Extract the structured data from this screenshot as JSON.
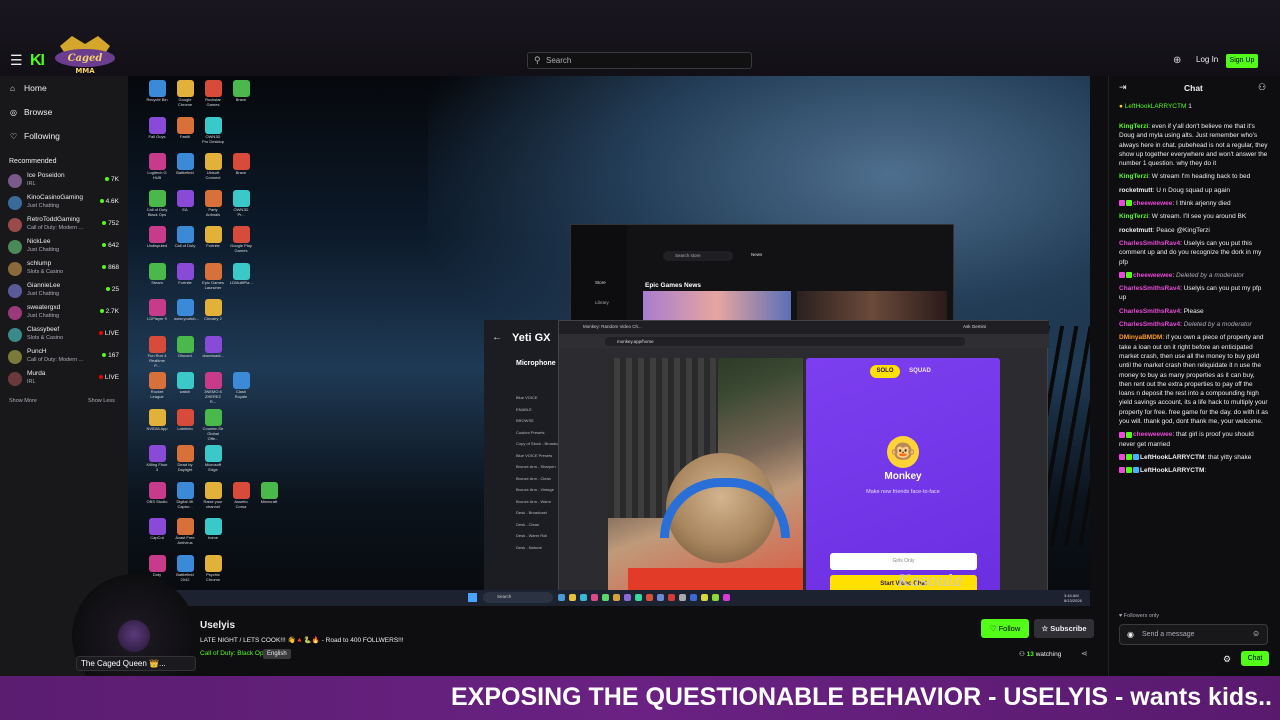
{
  "topbar": {
    "logo_text": "The Caged Queen MMA",
    "kick_text": "KI",
    "search_placeholder": "Search",
    "login_label": "Log In",
    "signup_label": "Sign Up"
  },
  "sidebar": {
    "nav": [
      {
        "label": "Home",
        "icon": "home-icon"
      },
      {
        "label": "Browse",
        "icon": "compass-icon"
      },
      {
        "label": "Following",
        "icon": "heart-icon"
      }
    ],
    "recommended_title": "Recommended",
    "channels": [
      {
        "name": "Ice Poseidon",
        "category": "IRL",
        "viewers": "7K",
        "live": false
      },
      {
        "name": "KinoCasinoGaming",
        "category": "Just Chatting",
        "viewers": "4.6K",
        "live": false
      },
      {
        "name": "RetroToddGaming",
        "category": "Call of Duty: Modern ...",
        "viewers": "752",
        "live": false
      },
      {
        "name": "NickLee",
        "category": "Just Chatting",
        "viewers": "642",
        "live": false
      },
      {
        "name": "schlump",
        "category": "Slots & Casino",
        "viewers": "868",
        "live": false
      },
      {
        "name": "GiannieLee",
        "category": "Just Chatting",
        "viewers": "25",
        "live": false
      },
      {
        "name": "sweatergxd",
        "category": "Just Chatting",
        "viewers": "2.7K",
        "live": false
      },
      {
        "name": "Classybeef",
        "category": "Slots & Casino",
        "viewers": "LIVE",
        "live": true
      },
      {
        "name": "PuncH",
        "category": "Call of Duty: Modern ...",
        "viewers": "167",
        "live": false
      },
      {
        "name": "Murda",
        "category": "IRL",
        "viewers": "LIVE",
        "live": true
      }
    ],
    "show_more": "Show More",
    "show_less": "Show Less"
  },
  "desktop": {
    "icons": [
      "Recycle Bin",
      "Google Chrome",
      "Rockstar Games",
      "Brave",
      "Fall Guys",
      "Fastill",
      "OWN3D Pro Desktop",
      "Logitech G HUB",
      "Battlefield",
      "Ubisoft Connect",
      "Brave",
      "Call of Duty Black Ops",
      "EA",
      "Party Animals",
      "OWN3D Pr...",
      "Undisputed",
      "Call of Duty",
      "Fortnite",
      "Google Play Games",
      "Steam",
      "Fortnite",
      "Epic Games Launcher",
      "LDMultiPla...",
      "LDPlayer 9",
      "www.youtub...",
      "Chivalry 2",
      "Fun Run 4 Realtime P...",
      "Discord",
      "downloadi...",
      "Rocket League",
      "watch",
      "3NEMO 8 ZHEREZ R...",
      "Clash Royale",
      "NVIDIA App",
      "Labirinto",
      "Counter-Str Global Offe...",
      "Killing Floor 3",
      "Dead by Daylight",
      "Microsoft Edge",
      "OBS Studio",
      "Digital 4K Captur...",
      "Raise your channel",
      "Assetto Corsa",
      "Minecraft",
      "CapCut",
      "Avast Free Antivirus",
      "home",
      "Duty",
      "Battlefield 2042",
      "Psychic Chrome"
    ],
    "epic": {
      "search": "Search store",
      "tab": "News",
      "store": "Store",
      "library": "Library",
      "heading": "Epic Games News"
    },
    "yeti": {
      "title": "Yeti GX",
      "mic": "Microphone",
      "rows": [
        "Blue VOICE",
        "ENABLE",
        "BROWSE",
        "Custom Presets",
        "Copy of Stock - Broadcast",
        "Blue VOICE Presets",
        "Bronze Arm - Sharpen",
        "Bronze Arm - Clean",
        "Bronze Arm - Vintage",
        "Bronze Arm - Warm",
        "Desk - Broadcast",
        "Desk - Clean",
        "Desk - Warm Roll",
        "Desk - Natural"
      ]
    },
    "monkey": {
      "tab_title": "Monkey: Random Video Ch...",
      "url": "monkey.app/home",
      "ask_label": "Ask Gemini",
      "solo": "SOLO",
      "squad": "SQUAD",
      "title": "Monkey",
      "subtitle": "Make new friends face-to-face",
      "girls_only": "Girls Only",
      "start": "Start Video Chat"
    },
    "taskbar": {
      "search": "Search",
      "time": "3:44 AM",
      "date": "8/13/2026"
    },
    "signature": "Kasoula"
  },
  "stream": {
    "streamer": "Uselyis",
    "title": "LATE NIGHT / LETS COOK!!! 👋🔺🐍🔥 - Road to 400 FOLLWERS!!!",
    "category": "Call of Duty: Black Ops",
    "language": "English",
    "follow_label": "Follow",
    "subscribe_label": "Subscribe",
    "viewer_count": "13",
    "watching_label": "watching",
    "overlay_tag": "The Caged Queen 👑..."
  },
  "chat": {
    "title": "Chat",
    "pinned": {
      "user": "LeftHookLARRYCTM",
      "count": "1"
    },
    "messages": [
      {
        "user": "KingTerzi",
        "color": "#53fc18",
        "text": "even if y'all don't believe me that it's Doug and myla using alts. Just remember who's always here in chat. pubehead is not a regular, they show up together everywhere and won't answer the number 1 question. why they do it",
        "badges": 0,
        "deleted": false
      },
      {
        "user": "KingTerzi",
        "color": "#53fc18",
        "text": "W stream I'm heading back to bed",
        "badges": 0,
        "deleted": false
      },
      {
        "user": "rocketmutt",
        "color": "#efeff1",
        "text": "U n Doug squad up again",
        "badges": 0,
        "deleted": false
      },
      {
        "user": "cheeweewee",
        "color": "#e94ad9",
        "text": "I think arjenny died",
        "badges": 2,
        "deleted": false
      },
      {
        "user": "KingTerzi",
        "color": "#53fc18",
        "text": "W stream. I'll see you around BK",
        "badges": 0,
        "deleted": false
      },
      {
        "user": "rocketmutt",
        "color": "#efeff1",
        "text": "Peace @KingTerzi",
        "badges": 0,
        "deleted": false
      },
      {
        "user": "CharlesSmithsRav4",
        "color": "#e94ad9",
        "text": "Uselyis can you put this comment up and do you recognize the dork in my pfp",
        "badges": 0,
        "deleted": false
      },
      {
        "user": "cheeweewee",
        "color": "#e94ad9",
        "text": "Deleted by a moderator",
        "badges": 2,
        "deleted": true
      },
      {
        "user": "CharlesSmithsRav4",
        "color": "#e94ad9",
        "text": "Uselyis can you put my pfp up",
        "badges": 0,
        "deleted": false
      },
      {
        "user": "CharlesSmithsRav4",
        "color": "#e94ad9",
        "text": "Please",
        "badges": 0,
        "deleted": false
      },
      {
        "user": "CharlesSmithsRav4",
        "color": "#e94ad9",
        "text": "Deleted by a moderator",
        "badges": 0,
        "deleted": true
      },
      {
        "user": "DMinyaBMDM",
        "color": "#ff9b1f",
        "text": "if you own a piece of property and take a loan out on it right before an enticipated market crash, then use all the money to buy gold until the market crash then reliquidate it n use the money to buy as many properties as it can buy, then rent out the extra properties to pay off the loans n deposit the rest into a compounding high yield savings account, its a life hack to multiply your property for free. free game for the day. do with it as you will. thank god, dont thank me, your welcome.",
        "badges": 0,
        "deleted": false
      },
      {
        "user": "cheeweewee",
        "color": "#e94ad9",
        "text": "that girl is proof you should never get married",
        "badges": 2,
        "deleted": false
      },
      {
        "user": "LeftHookLARRYCTM",
        "color": "#efeff1",
        "text": "that yitty shake",
        "badges": 3,
        "deleted": false
      },
      {
        "user": "LeftHookLARRYCTM",
        "color": "#efeff1",
        "text": "",
        "badges": 3,
        "deleted": false
      }
    ],
    "followers_only": "Followers only",
    "input_placeholder": "Send a message",
    "chat_button": "Chat"
  },
  "banner": {
    "text": "EXPOSING THE QUESTIONABLE BEHAVIOR - USELYIS - wants kids.."
  },
  "colors": {
    "accent": "#53fc18",
    "banner": "#6a2183",
    "monkey": "#7c3ff0",
    "background": "#0e0e10"
  }
}
